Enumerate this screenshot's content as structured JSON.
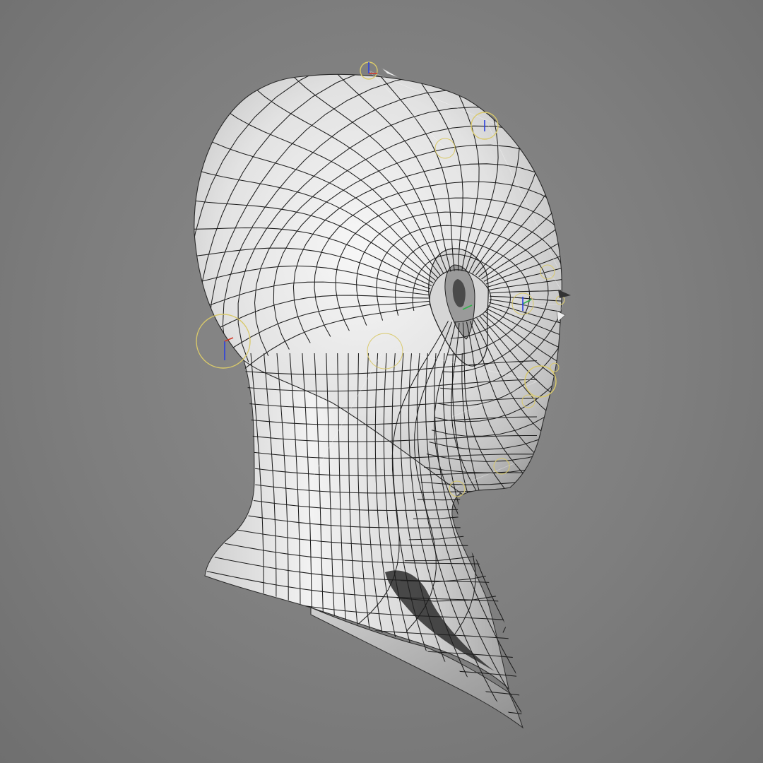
{
  "viewport": {
    "background_color": "#808080",
    "mesh_fill_color": "#e4e4e4",
    "wire_color": "#1d1d1d",
    "handle_color": "#d9c96a",
    "gizmo_colors": {
      "x": "#d23a2a",
      "y": "#2b3fe0",
      "z": "#2fb54a"
    }
  },
  "model": {
    "icon": "head-mesh-icon"
  }
}
